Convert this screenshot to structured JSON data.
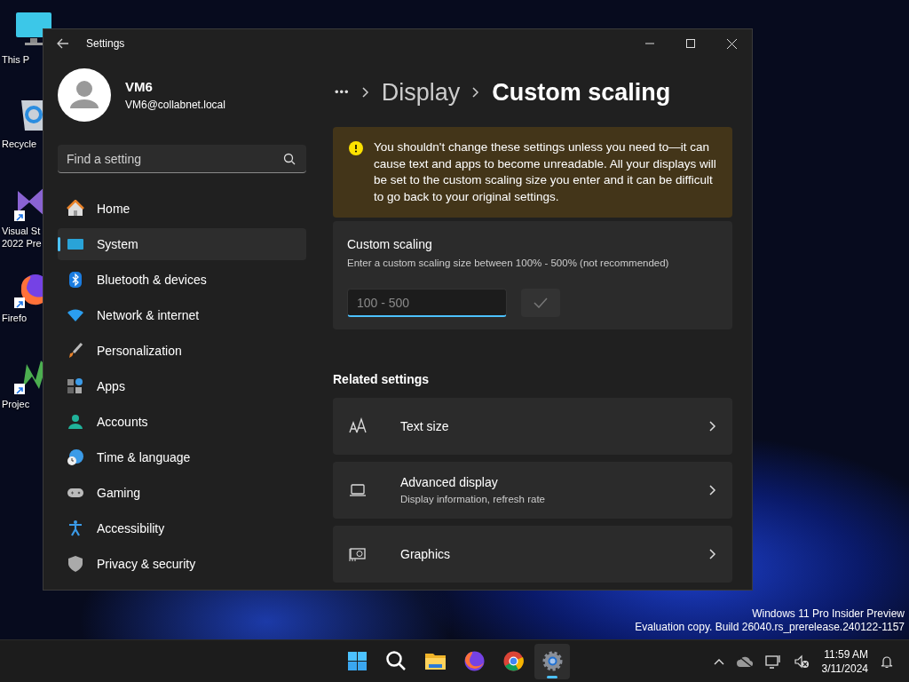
{
  "desktop": {
    "icons": [
      {
        "lines": [
          "This P"
        ],
        "shortcut": false
      },
      {
        "lines": [
          "Recycle"
        ],
        "shortcut": false
      },
      {
        "lines": [
          "Visual St",
          "2022 Pre"
        ],
        "shortcut": true
      },
      {
        "lines": [
          "Firefo"
        ],
        "shortcut": true
      },
      {
        "lines": [
          "Projec"
        ],
        "shortcut": true
      }
    ],
    "watermark": [
      "Windows 11 Pro Insider Preview",
      "Evaluation copy. Build 26040.rs_prerelease.240122-1157"
    ]
  },
  "window": {
    "title": "Settings",
    "user": {
      "name": "VM6",
      "email": "VM6@collabnet.local"
    },
    "search": {
      "placeholder": "Find a setting"
    },
    "nav": [
      {
        "label": "Home",
        "selected": false
      },
      {
        "label": "System",
        "selected": true
      },
      {
        "label": "Bluetooth & devices",
        "selected": false
      },
      {
        "label": "Network & internet",
        "selected": false
      },
      {
        "label": "Personalization",
        "selected": false
      },
      {
        "label": "Apps",
        "selected": false
      },
      {
        "label": "Accounts",
        "selected": false
      },
      {
        "label": "Time & language",
        "selected": false
      },
      {
        "label": "Gaming",
        "selected": false
      },
      {
        "label": "Accessibility",
        "selected": false
      },
      {
        "label": "Privacy & security",
        "selected": false
      }
    ],
    "breadcrumb": {
      "overflow": "•••",
      "items": [
        "Display",
        "Custom scaling"
      ]
    },
    "warning": "You shouldn't change these settings unless you need to—it can cause text and apps to become unreadable. All your displays will be set to the custom scaling size you enter and it can be difficult to go back to your original settings.",
    "custom_scaling": {
      "title": "Custom scaling",
      "description": "Enter a custom scaling size between 100% - 500% (not recommended)",
      "input": {
        "placeholder": "100 - 500"
      },
      "confirm": {
        "disabled": true
      }
    },
    "related": {
      "heading": "Related settings",
      "items": [
        {
          "title": "Text size"
        },
        {
          "title": "Advanced display",
          "subtitle": "Display information, refresh rate"
        },
        {
          "title": "Graphics"
        }
      ]
    }
  },
  "taskbar": {
    "apps": [
      {
        "selected": false
      },
      {
        "selected": false
      },
      {
        "selected": false
      },
      {
        "selected": false
      },
      {
        "selected": false
      },
      {
        "selected": true
      }
    ],
    "time": "11:59 AM",
    "date": "3/11/2024"
  }
}
